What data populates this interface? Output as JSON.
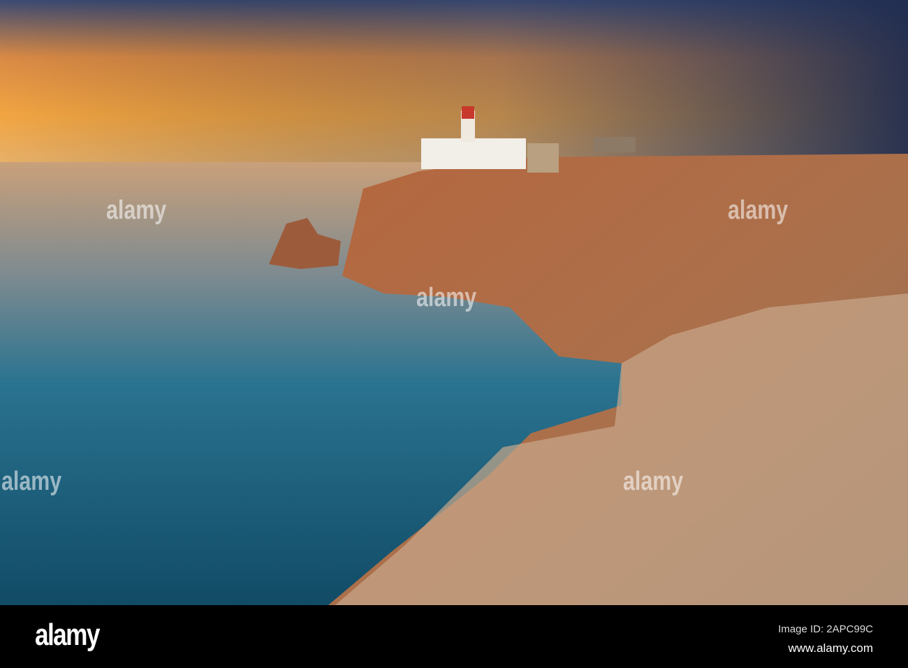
{
  "watermark": {
    "brand": "alamy"
  },
  "footer": {
    "logo": "alamy",
    "image_id": "Image ID: 2APC99C",
    "website": "www.alamy.com"
  },
  "colors": {
    "sky_orange": "#f0a040",
    "sky_blue": "#2d3d63",
    "sea": "#1f6f8f",
    "cliff": "#b5673e"
  }
}
